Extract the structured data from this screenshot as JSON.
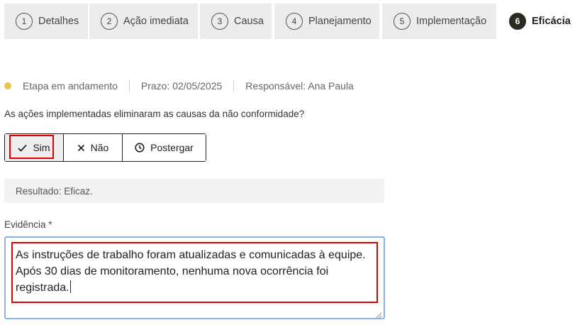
{
  "tabs": [
    {
      "num": "1",
      "label": "Detalhes"
    },
    {
      "num": "2",
      "label": "Ação imediata"
    },
    {
      "num": "3",
      "label": "Causa"
    },
    {
      "num": "4",
      "label": "Planejamento"
    },
    {
      "num": "5",
      "label": "Implementação"
    },
    {
      "num": "6",
      "label": "Eficácia",
      "active": true
    }
  ],
  "status": {
    "stage": "Etapa em andamento",
    "deadline": "Prazo: 02/05/2025",
    "owner": "Responsável: Ana Paula",
    "dot_color": "#eac54f"
  },
  "question": "As ações implementadas eliminaram as causas da não conformidade?",
  "options": {
    "yes": {
      "label": "Sim",
      "icon": "check-icon",
      "selected": true
    },
    "no": {
      "label": "Não",
      "icon": "x-icon"
    },
    "postpone": {
      "label": "Postergar",
      "icon": "clock-icon"
    }
  },
  "result": "Resultado: Eficaz.",
  "evidence": {
    "label": "Evidência *",
    "value": "As instruções de trabalho foram atualizadas e comunicadas à equipe.\nApós 30 dias de monitoramento, nenhuma nova ocorrência foi\nregistrada."
  }
}
